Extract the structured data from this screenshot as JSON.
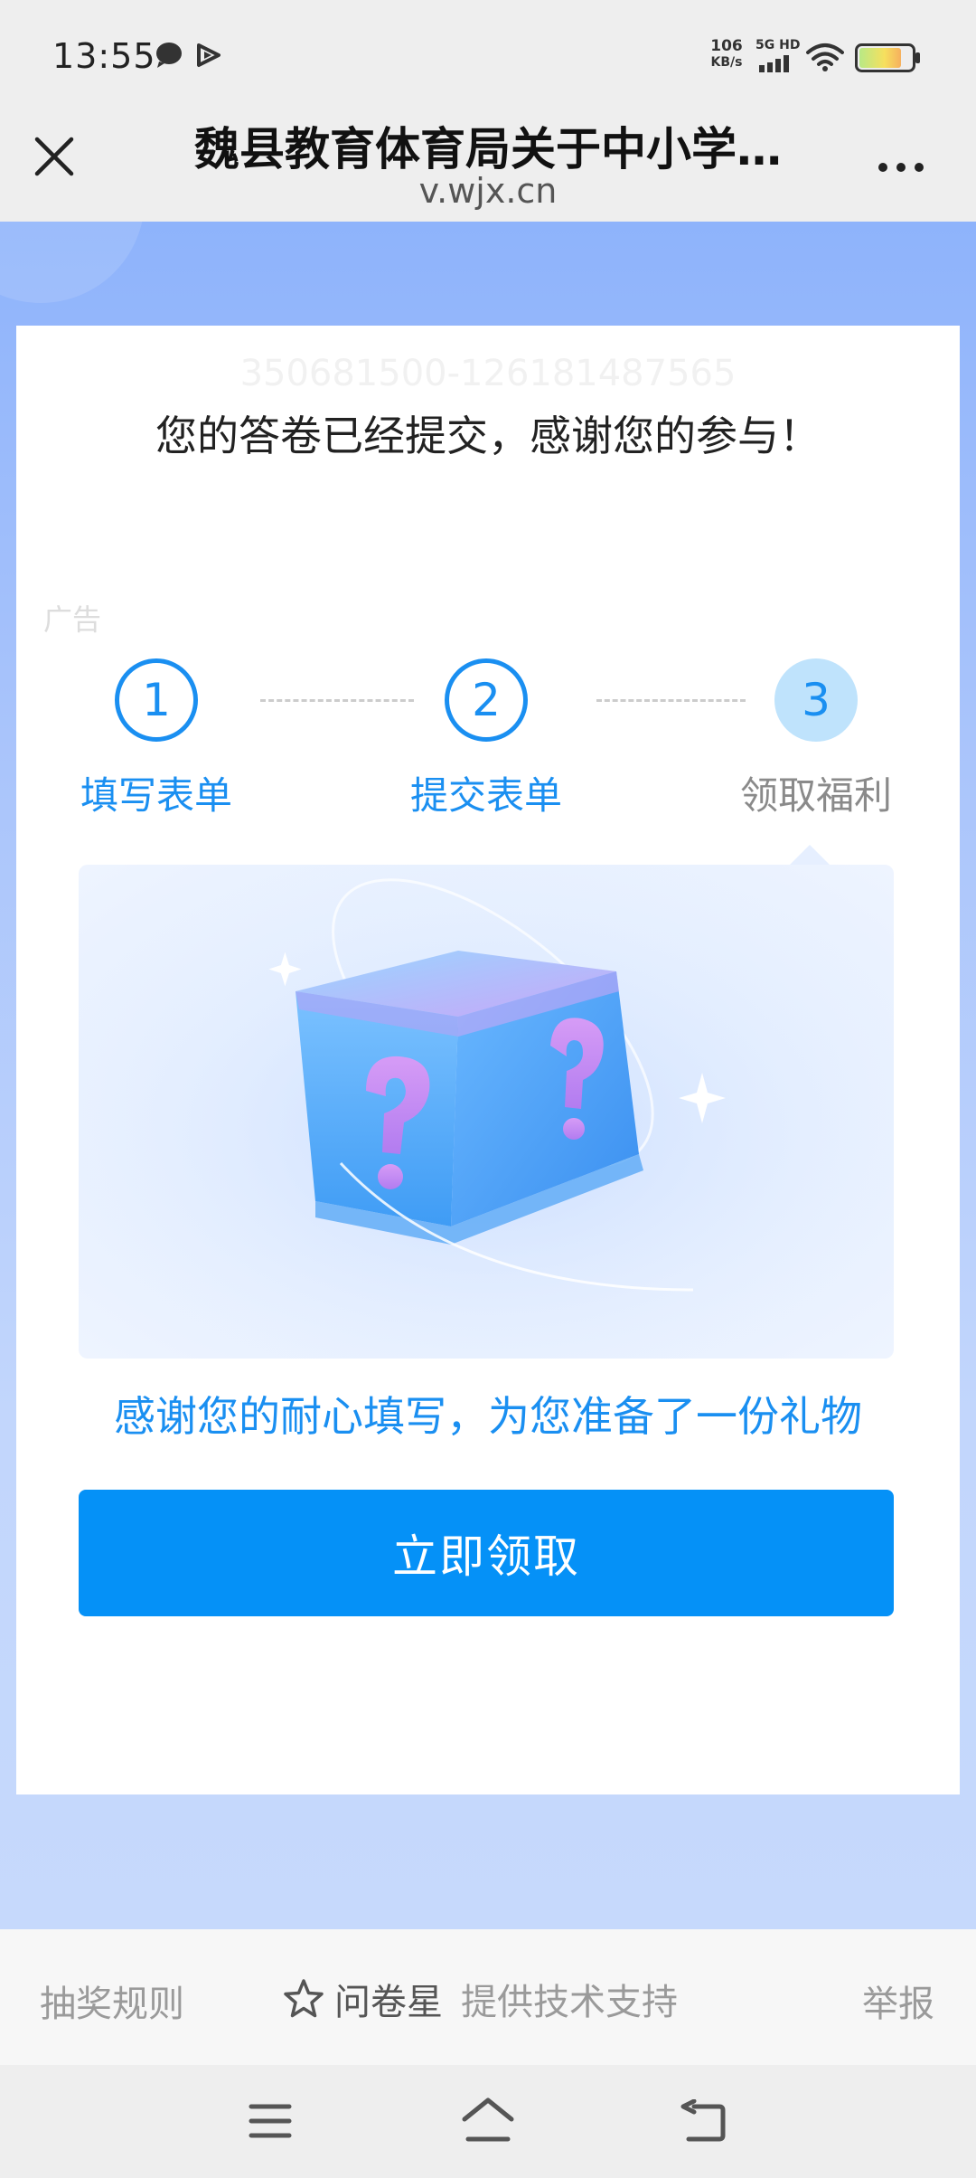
{
  "status_bar": {
    "time": "13:55",
    "net_speed_value": "106",
    "net_speed_unit": "KB/s",
    "network_label": "5G HD",
    "icons": [
      "chat-icon",
      "play-icon",
      "signal-icon",
      "wifi-icon",
      "battery-icon"
    ]
  },
  "browser": {
    "title": "魏县教育体育局关于中小学…",
    "url": "v.wjx.cn",
    "close_icon": "close-icon",
    "more_icon": "more-icon"
  },
  "card": {
    "watermark_id": "350681500-126181487565",
    "success_message": "您的答卷已经提交，感谢您的参与！",
    "ad_label": "广告",
    "steps": [
      {
        "number": "1",
        "label": "填写表单"
      },
      {
        "number": "2",
        "label": "提交表单"
      },
      {
        "number": "3",
        "label": "领取福利"
      }
    ],
    "gift_illustration": "mystery-box-illustration",
    "thanks_message": "感谢您的耐心填写，为您准备了一份礼物",
    "claim_button": "立即领取"
  },
  "footer": {
    "rules": "抽奖规则",
    "brand": "问卷星",
    "support": "提供技术支持",
    "report": "举报"
  },
  "nav": {
    "icons": [
      "menu-icon",
      "home-icon",
      "back-icon"
    ]
  },
  "colors": {
    "accent": "#1a8ff1",
    "button": "#0591f7",
    "page_bg_top": "#8eb3fb",
    "page_bg_bottom": "#c6d9fc"
  }
}
